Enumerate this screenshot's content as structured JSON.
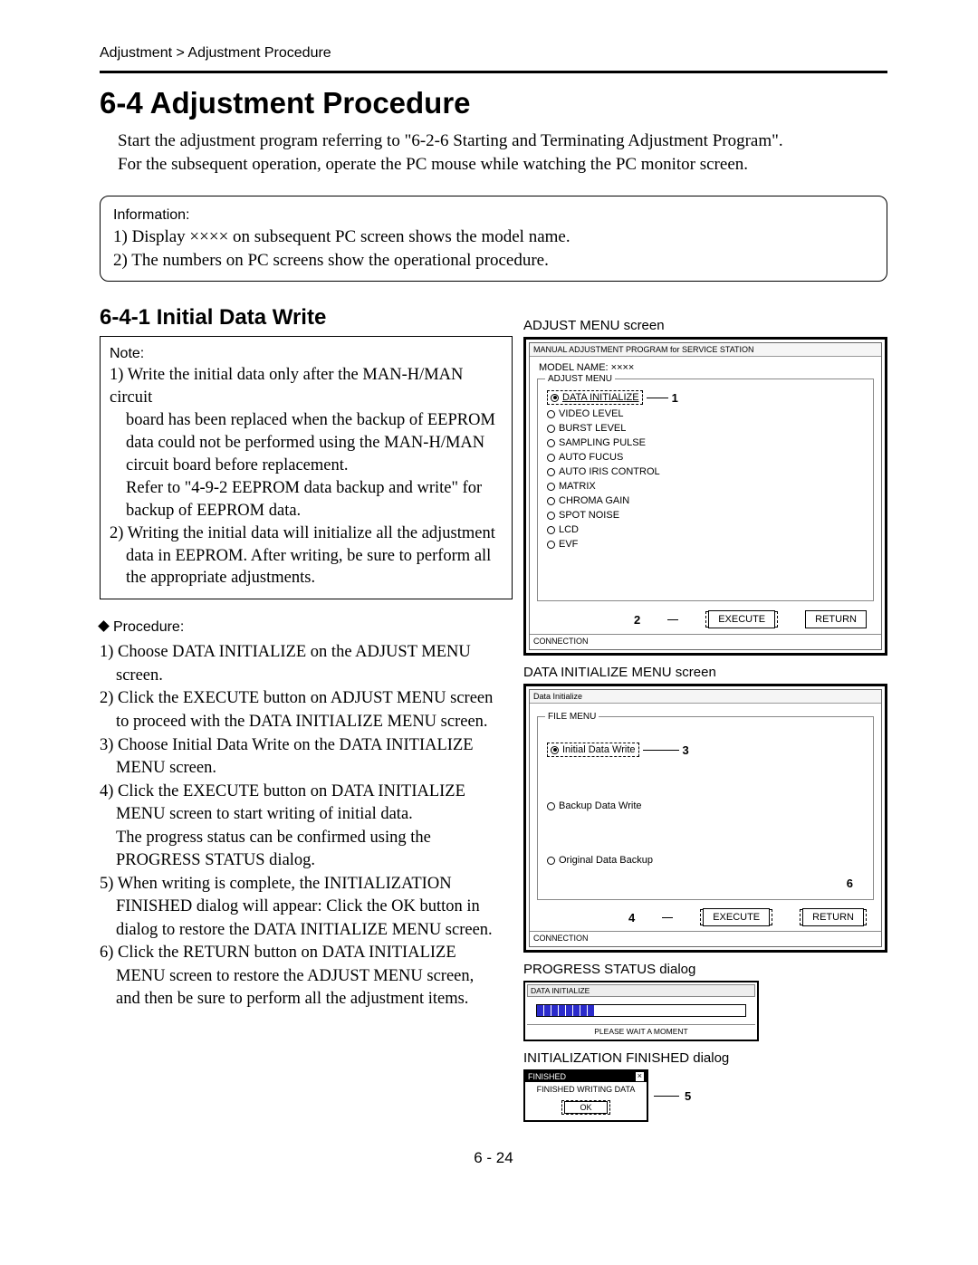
{
  "breadcrumb": "Adjustment > Adjustment Procedure",
  "section_title": "6-4 Adjustment Procedure",
  "intro_p1": "Start the adjustment program referring to \"6-2-6 Starting and Terminating Adjustment Program\".",
  "intro_p2": "For the subsequent operation, operate the PC mouse while watching the PC monitor screen.",
  "info_label": "Information:",
  "info_line1": "1) Display ×××× on subsequent PC screen shows the model name.",
  "info_line2": "2) The numbers on PC screens show the operational procedure.",
  "subsection_title": "6-4-1  Initial Data Write",
  "note_label": "Note:",
  "note_1a": "1) Write the initial data only after the MAN-H/MAN circuit",
  "note_1b": "board has been replaced when the backup of EEPROM",
  "note_1c": "data could not be performed using the MAN-H/MAN",
  "note_1d": "circuit board before replacement.",
  "note_1e": "Refer to \"4-9-2 EEPROM data backup and write\" for",
  "note_1f": "backup of EEPROM data.",
  "note_2a": "2) Writing the initial data will initialize all the adjustment",
  "note_2b": "data in EEPROM. After writing, be sure to perform all",
  "note_2c": "the appropriate adjustments.",
  "proc_label": "Procedure:",
  "proc_1a": "1) Choose DATA INITIALIZE on the ADJUST MENU",
  "proc_1b": "screen.",
  "proc_2a": "2) Click the EXECUTE button on ADJUST MENU  screen",
  "proc_2b": "to proceed with the DATA INITIALIZE MENU screen.",
  "proc_3a": "3) Choose Initial Data Write on the DATA INITIALIZE",
  "proc_3b": "MENU screen.",
  "proc_4a": "4) Click the EXECUTE button on DATA INITIALIZE",
  "proc_4b": "MENU screen to start writing of initial data.",
  "proc_4c": "The progress status can be confirmed using the",
  "proc_4d": "PROGRESS STATUS dialog.",
  "proc_5a": "5) When writing is complete, the INITIALIZATION",
  "proc_5b": "FINISHED dialog will appear: Click the OK button in",
  "proc_5c": "dialog to restore the DATA INITIALIZE MENU screen.",
  "proc_6a": "6) Click the RETURN button on DATA INITIALIZE",
  "proc_6b": "MENU screen to restore the ADJUST MENU screen,",
  "proc_6c": "and then be sure to perform all the adjustment items.",
  "adjust_menu": {
    "label": "ADJUST MENU screen",
    "titlebar": "MANUAL ADJUSTMENT PROGRAM for SERVICE STATION",
    "model": "MODEL NAME: ××××",
    "group": "ADJUST MENU",
    "items": [
      "DATA INITIALIZE",
      "VIDEO LEVEL",
      "BURST LEVEL",
      "SAMPLING PULSE",
      "AUTO FUCUS",
      "AUTO IRIS CONTROL",
      "MATRIX",
      "CHROMA GAIN",
      "SPOT NOISE",
      "LCD",
      "EVF"
    ],
    "callout_1": "1",
    "callout_2": "2",
    "execute": "EXECUTE",
    "return": "RETURN",
    "connection": "CONNECTION"
  },
  "data_init_menu": {
    "label": "DATA INITIALIZE MENU screen",
    "titlebar": "Data Initialize",
    "group": "FILE MENU",
    "items": [
      "Initial Data Write",
      "Backup Data Write",
      "Original Data Backup"
    ],
    "callout_3": "3",
    "callout_4": "4",
    "callout_6": "6",
    "execute": "EXECUTE",
    "return": "RETURN",
    "connection": "CONNECTION"
  },
  "progress_dialog": {
    "label": "PROGRESS STATUS dialog",
    "title": "DATA INITIALIZE",
    "message": "PLEASE WAIT A MOMENT"
  },
  "finished_dialog": {
    "label": "INITIALIZATION FINISHED dialog",
    "title": "FINISHED",
    "close": "×",
    "body": "FINISHED WRITING DATA",
    "ok": "OK",
    "callout_5": "5"
  },
  "page_number": "6 - 24"
}
